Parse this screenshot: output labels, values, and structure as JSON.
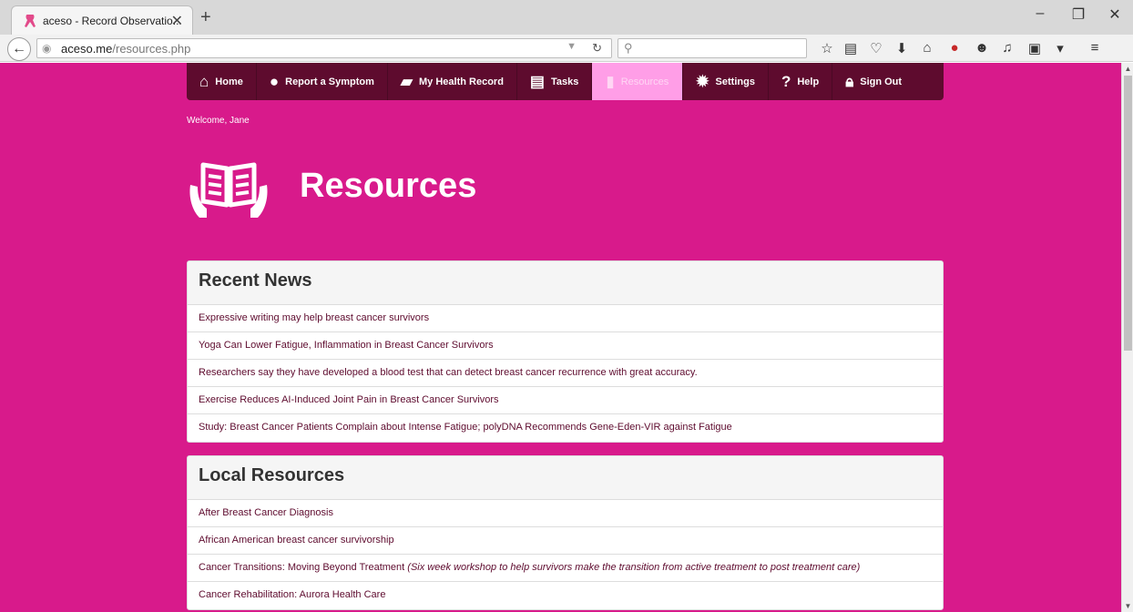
{
  "browser": {
    "tab_title": "aceso - Record Observatio...",
    "url_host": "aceso.me",
    "url_path": "/resources.php",
    "search_placeholder": ""
  },
  "nav": {
    "items": [
      {
        "label": "Home",
        "icon": "home-icon"
      },
      {
        "label": "Report a Symptom",
        "icon": "person-icon"
      },
      {
        "label": "My Health Record",
        "icon": "folder-icon"
      },
      {
        "label": "Tasks",
        "icon": "list-icon"
      },
      {
        "label": "Resources",
        "icon": "book-icon",
        "active": true
      },
      {
        "label": "Settings",
        "icon": "gear-icon"
      },
      {
        "label": "Help",
        "icon": "question-icon"
      },
      {
        "label": "Sign Out",
        "icon": "lock-icon"
      }
    ]
  },
  "welcome": "Welcome, Jane",
  "page_title": "Resources",
  "recent_news": {
    "title": "Recent News",
    "items": [
      "Expressive writing may help breast cancer survivors",
      "Yoga Can Lower Fatigue, Inflammation in Breast Cancer Survivors",
      "Researchers say they have developed a blood test that can detect breast cancer recurrence with great accuracy.",
      "Exercise Reduces AI-Induced Joint Pain in Breast Cancer Survivors",
      "Study: Breast Cancer Patients Complain about Intense Fatigue; polyDNA Recommends Gene-Eden-VIR against Fatigue"
    ]
  },
  "local_resources": {
    "title": "Local Resources",
    "items": [
      {
        "label": "After Breast Cancer Diagnosis",
        "note": ""
      },
      {
        "label": "African American breast cancer survivorship",
        "note": ""
      },
      {
        "label": "Cancer Transitions: Moving Beyond Treatment",
        "note": "(Six week workshop to help survivors make the transition from active treatment to post treatment care)"
      },
      {
        "label": "Cancer Rehabilitation: Aurora Health Care",
        "note": ""
      }
    ]
  },
  "colors": {
    "page_bg": "#d81a8b",
    "nav_bg": "#5e0b2e",
    "nav_active": "#ff9ee7"
  }
}
